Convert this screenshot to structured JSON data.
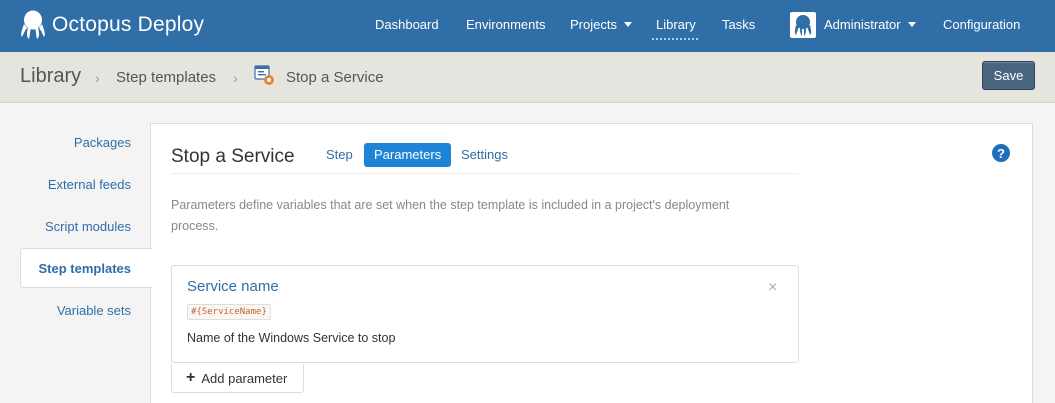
{
  "app": {
    "brand": "Octopus Deploy"
  },
  "nav": {
    "dashboard": "Dashboard",
    "environments": "Environments",
    "projects": "Projects",
    "library": "Library",
    "tasks": "Tasks",
    "user": "Administrator",
    "configuration": "Configuration"
  },
  "breadcrumb": {
    "root": "Library",
    "step_templates": "Step templates",
    "current": "Stop a Service",
    "save_label": "Save"
  },
  "sidebar": {
    "items": [
      {
        "label": "Packages"
      },
      {
        "label": "External feeds"
      },
      {
        "label": "Script modules"
      },
      {
        "label": "Step templates"
      },
      {
        "label": "Variable sets"
      }
    ]
  },
  "main": {
    "title": "Stop a Service",
    "tabs": [
      {
        "label": "Step"
      },
      {
        "label": "Parameters"
      },
      {
        "label": "Settings"
      }
    ],
    "active_tab": "Parameters",
    "description": "Parameters define variables that are set when the step template is included in a project's deployment process.",
    "parameter": {
      "name": "Service name",
      "token": "#{ServiceName}",
      "help": "Name of the Windows Service to stop"
    },
    "add_parameter_label": "Add parameter"
  },
  "colors": {
    "header": "#2f6ea7",
    "accent": "#1e84d8",
    "save_button": "#4a6580"
  },
  "icons": {
    "brand": "octopus-logo-icon",
    "help": "help-icon",
    "close": "close-icon",
    "add": "plus-icon",
    "template": "step-template-icon"
  }
}
